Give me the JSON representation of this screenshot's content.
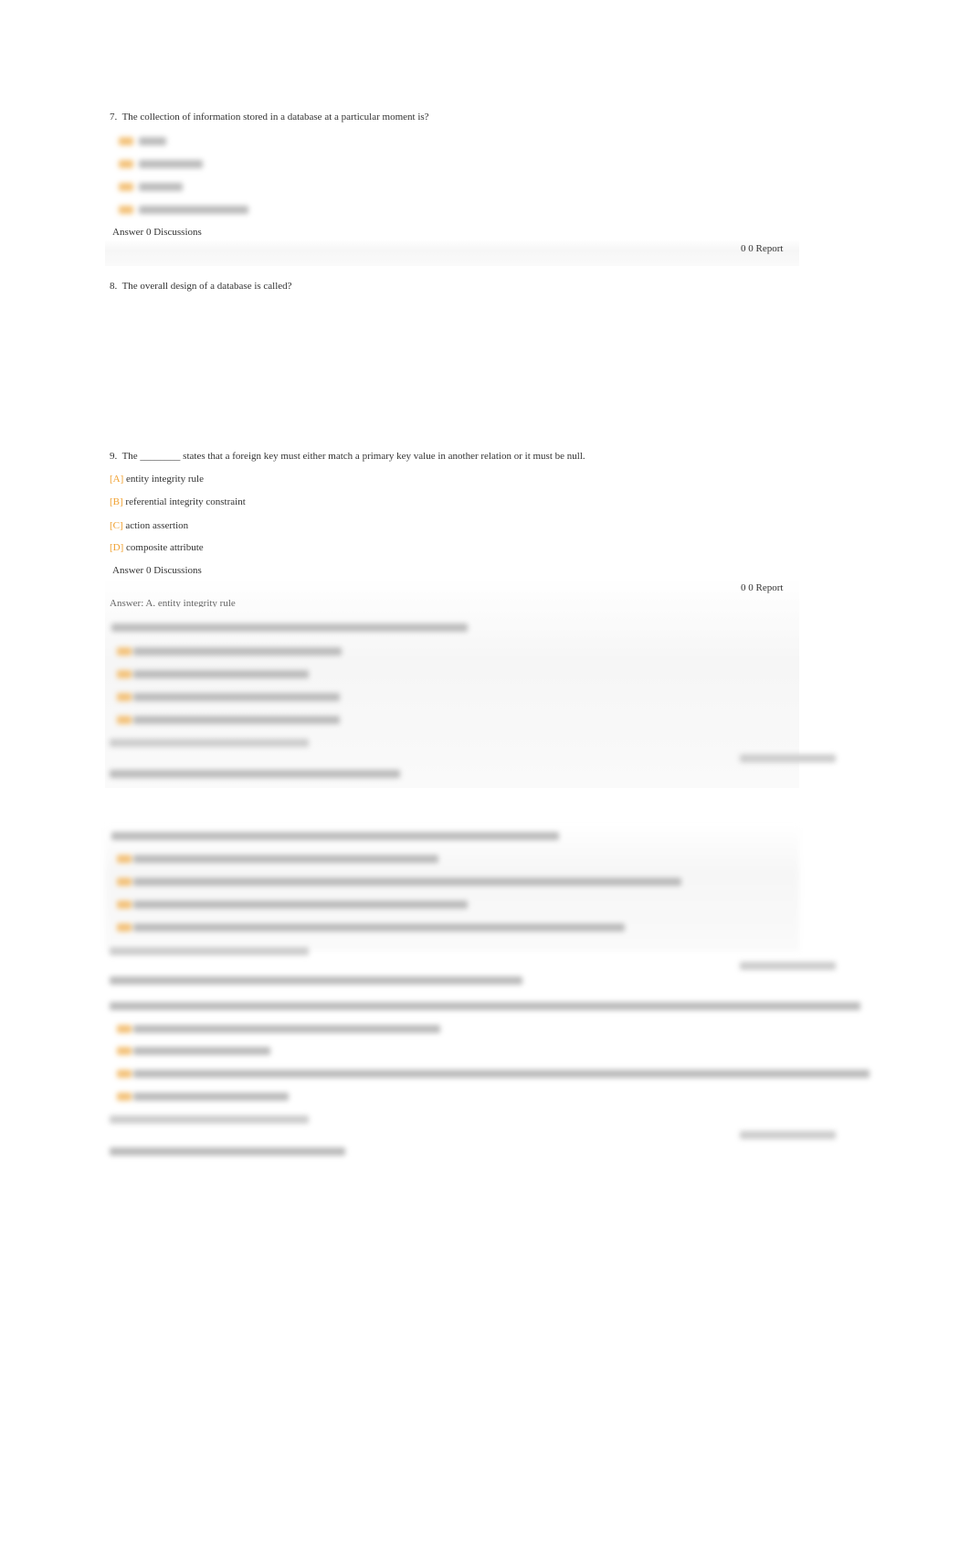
{
  "q7": {
    "number": "7.",
    "text": "The collection of information stored in a database at a particular moment is?",
    "discussions": "Answer 0 Discussions",
    "report": "0 0 Report"
  },
  "q8": {
    "number": "8.",
    "text": "The overall design of a database is called?"
  },
  "q9": {
    "number": "9.",
    "text": "The ________ states that a foreign key must either match a primary key value in another relation or it must be null.",
    "options": [
      {
        "letter": "[A]",
        "text": "entity integrity rule"
      },
      {
        "letter": "[B]",
        "text": "referential integrity constraint"
      },
      {
        "letter": "[C]",
        "text": "action assertion"
      },
      {
        "letter": "[D]",
        "text": "composite attribute"
      }
    ],
    "discussions": "Answer 0 Discussions",
    "report": "0 0 Report",
    "answer": "Answer:   A. entity integrity rule"
  },
  "colors": {
    "option_letter": "#f0a030"
  }
}
